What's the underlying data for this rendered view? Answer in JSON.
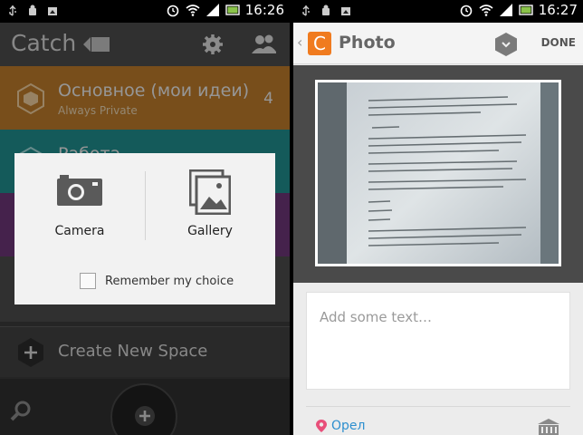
{
  "status_bar_left": {
    "time": "16:26"
  },
  "status_bar_right": {
    "time": "16:27"
  },
  "catch_app": {
    "logo": "Catch",
    "spaces": [
      {
        "title": "Основное (мои идеи)",
        "subtitle": "Always Private",
        "count": "4",
        "color": "#b8782a"
      },
      {
        "title": "Работа",
        "color": "#1f8a8a"
      },
      {
        "color": "#6b3575"
      }
    ],
    "create_space_label": "Create New Space"
  },
  "chooser_dialog": {
    "camera_label": "Camera",
    "gallery_label": "Gallery",
    "remember_label": "Remember my choice"
  },
  "photo_screen": {
    "badge_letter": "C",
    "title": "Photo",
    "done_label": "DONE",
    "text_placeholder": "Add some text…",
    "location": "Орел",
    "accent_color": "#f07b1f"
  }
}
